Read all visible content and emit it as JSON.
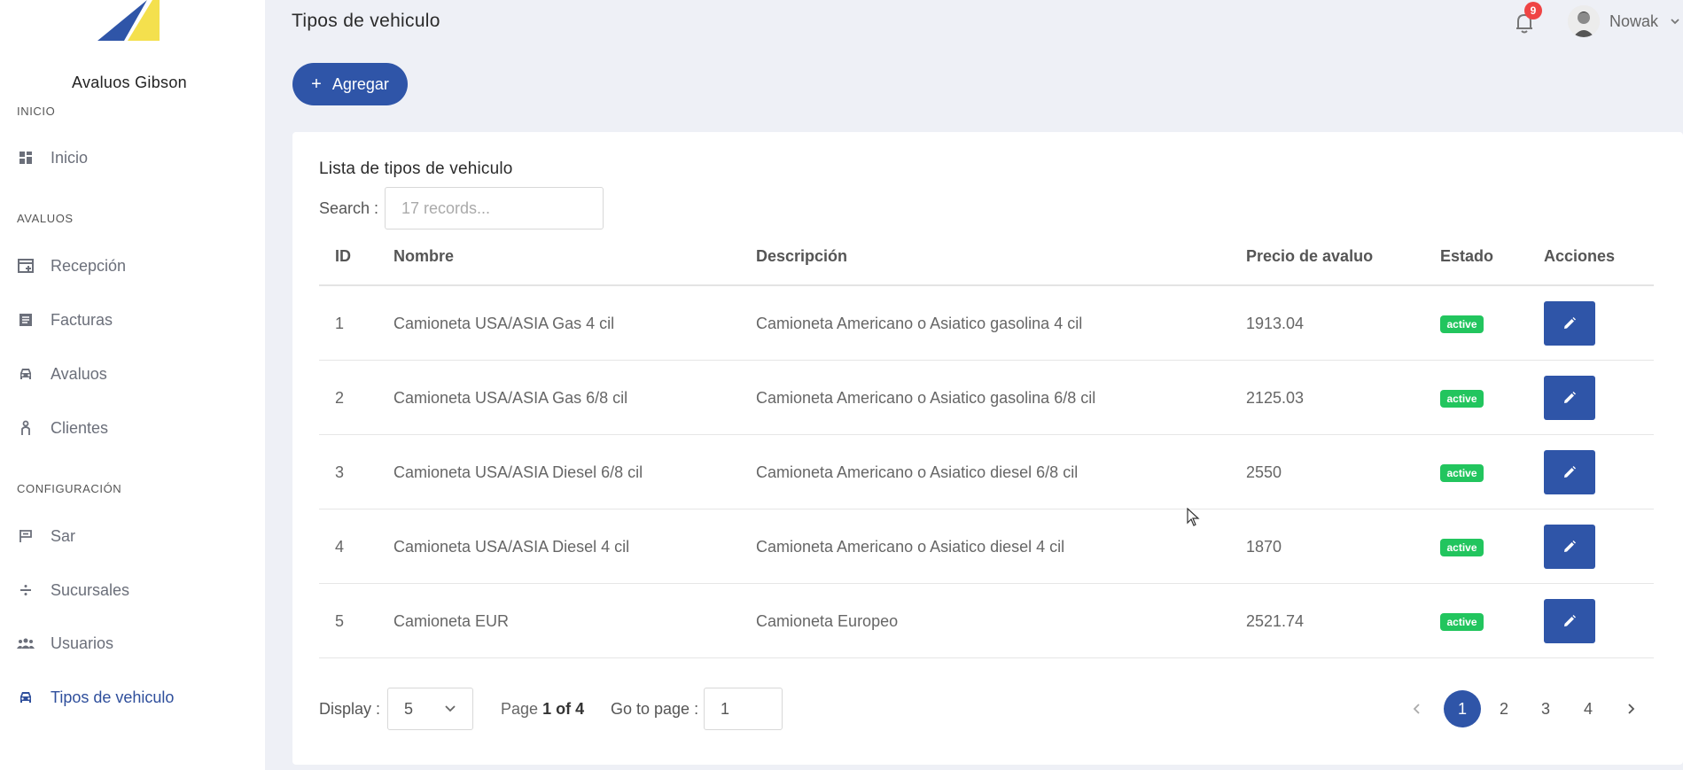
{
  "app": {
    "brand": "Avaluos Gibson",
    "colors": {
      "primary": "#2f55a8",
      "success": "#22c55e",
      "danger": "#ef4444",
      "background": "#eef0f6"
    }
  },
  "sidebar": {
    "sections": [
      "INICIO",
      "AVALUOS",
      "CONFIGURACIÓN"
    ],
    "items": [
      {
        "label": "Inicio",
        "icon": "dashboard-icon"
      },
      {
        "label": "Recepción",
        "icon": "calendar-add-icon"
      },
      {
        "label": "Facturas",
        "icon": "document-icon"
      },
      {
        "label": "Avaluos",
        "icon": "car-icon"
      },
      {
        "label": "Clientes",
        "icon": "person-icon"
      },
      {
        "label": "Sar",
        "icon": "flag-icon"
      },
      {
        "label": "Sucursales",
        "icon": "divide-icon"
      },
      {
        "label": "Usuarios",
        "icon": "group-icon"
      },
      {
        "label": "Tipos de vehiculo",
        "icon": "car-icon",
        "active": true
      }
    ]
  },
  "header": {
    "title": "Tipos de vehiculo",
    "notifications": "9",
    "user": "Nowak"
  },
  "toolbar": {
    "add_label": "Agregar"
  },
  "card": {
    "title": "Lista de tipos de vehiculo",
    "search_label": "Search :",
    "search_placeholder": "17 records..."
  },
  "table": {
    "columns": [
      "ID",
      "Nombre",
      "Descripción",
      "Precio de avaluo",
      "Estado",
      "Acciones"
    ],
    "rows": [
      {
        "id": "1",
        "nombre": "Camioneta USA/ASIA Gas 4 cil",
        "descripcion": "Camioneta Americano o Asiatico gasolina 4 cil",
        "precio": "1913.04",
        "estado": "active"
      },
      {
        "id": "2",
        "nombre": "Camioneta USA/ASIA Gas 6/8 cil",
        "descripcion": "Camioneta Americano o Asiatico gasolina 6/8 cil",
        "precio": "2125.03",
        "estado": "active"
      },
      {
        "id": "3",
        "nombre": "Camioneta USA/ASIA Diesel 6/8 cil",
        "descripcion": "Camioneta Americano o Asiatico diesel 6/8 cil",
        "precio": "2550",
        "estado": "active"
      },
      {
        "id": "4",
        "nombre": "Camioneta USA/ASIA Diesel 4 cil",
        "descripcion": "Camioneta Americano o Asiatico diesel 4 cil",
        "precio": "1870",
        "estado": "active"
      },
      {
        "id": "5",
        "nombre": "Camioneta EUR",
        "descripcion": "Camioneta Europeo",
        "precio": "2521.74",
        "estado": "active"
      }
    ]
  },
  "pagination": {
    "display_label": "Display :",
    "display_value": "5",
    "page_prefix": "Page",
    "page_of": "1 of 4",
    "goto_label": "Go to page :",
    "goto_value": "1",
    "pages": [
      "1",
      "2",
      "3",
      "4"
    ],
    "current": "1"
  }
}
